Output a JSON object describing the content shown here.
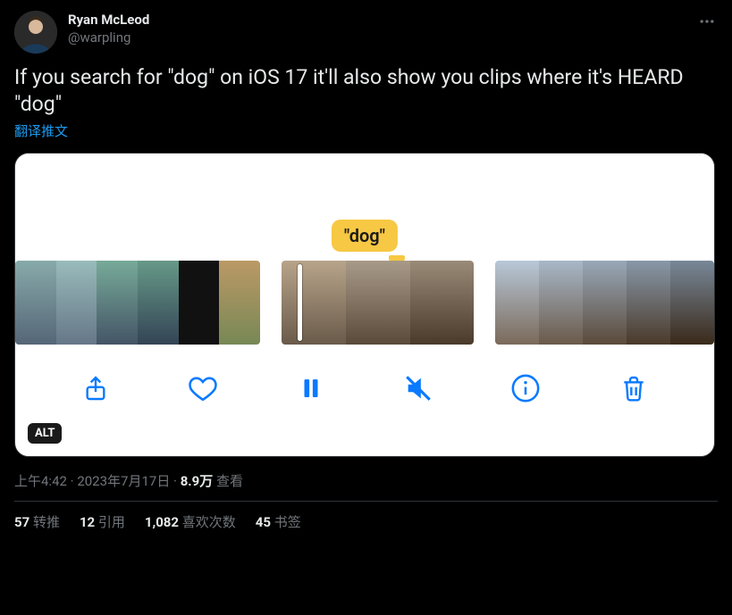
{
  "author": {
    "display_name": "Ryan McLeod",
    "handle": "@warpling"
  },
  "tweet_text": "If you search for \"dog\" on iOS 17 it'll also show you clips where it's HEARD \"dog\"",
  "translate_label": "翻译推文",
  "media": {
    "search_tag": "\"dog\"",
    "alt_badge": "ALT"
  },
  "meta": {
    "time": "上午4:42",
    "dot1": " · ",
    "date": "2023年7月17日",
    "dot2": " · ",
    "views_count": "8.9万",
    "views_label": " 查看"
  },
  "stats": {
    "retweets_count": "57",
    "retweets_label": " 转推",
    "quotes_count": "12",
    "quotes_label": " 引用",
    "likes_count": "1,082",
    "likes_label": " 喜欢次数",
    "bookmarks_count": "45",
    "bookmarks_label": " 书签"
  }
}
